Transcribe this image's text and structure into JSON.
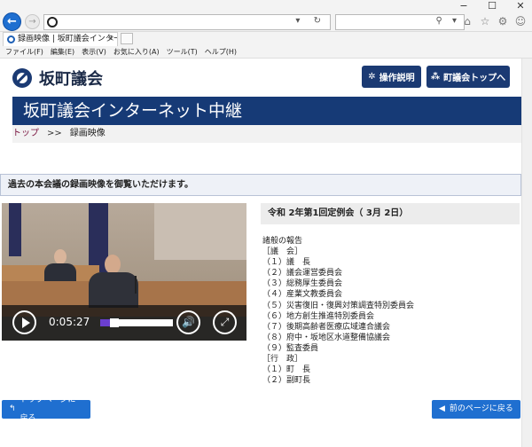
{
  "browser": {
    "window_controls": [
      "−",
      "☐",
      "✕"
    ],
    "address_tools": "▾ ↻",
    "search_tools": "⚲ ▾",
    "tab_title": "録画映像 | 坂町議会インター...",
    "tab_close": "×",
    "menu": [
      "ファイル(F)",
      "編集(E)",
      "表示(V)",
      "お気に入り(A)",
      "ツール(T)",
      "ヘルプ(H)"
    ]
  },
  "site": {
    "name": "坂町議会",
    "help_button": "操作説明",
    "top_button": "町議会トップへ",
    "banner": "坂町議会インターネット中継"
  },
  "breadcrumb": {
    "home": "トップ",
    "separator": ">>",
    "current": "録画映像"
  },
  "notice": "過去の本会議の録画映像を御覧いただけます。",
  "video": {
    "time": "0:05:27",
    "progress_fraction": 0.14
  },
  "session": {
    "title": "令和 2年第1回定例会（ 3月 2日）",
    "agenda": [
      "諸般の報告",
      "［議　会］",
      "（１）議　長",
      "（２）議会運営委員会",
      "（３）総務厚生委員会",
      "（４）産業文教委員会",
      "（５）災害復旧・復興対策調査特別委員会",
      "（６）地方創生推進特別委員会",
      "（７）後期高齢者医療広域連合議会",
      "（８）府中・坂地区水道整備協議会",
      "（９）監査委員",
      "［行　政］",
      "（１）町　長",
      "（２）副町長"
    ]
  },
  "footer": {
    "back_top": "トップページに戻る",
    "back_prev": "前のページに戻る"
  }
}
